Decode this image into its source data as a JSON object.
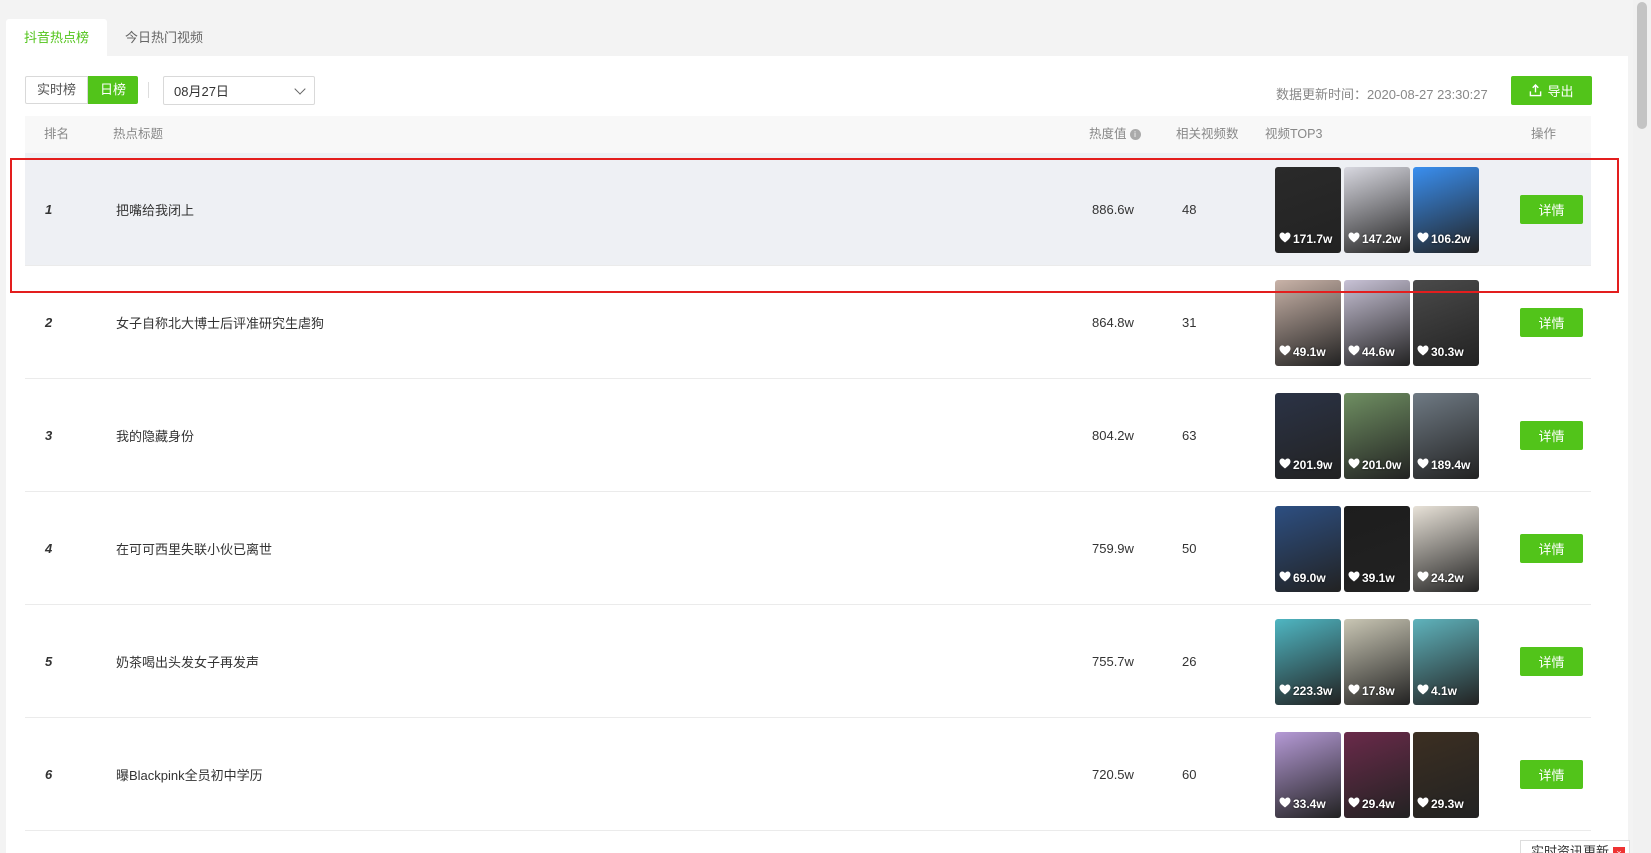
{
  "tabs": [
    {
      "label": "抖音热点榜",
      "active": true
    },
    {
      "label": "今日热门视频",
      "active": false
    }
  ],
  "toolbar": {
    "realtime_label": "实时榜",
    "daily_label": "日榜",
    "date_value": "08月27日",
    "update_text": "数据更新时间：2020-08-27 23:30:27",
    "export_label": "导出"
  },
  "table": {
    "headers": {
      "rank": "排名",
      "title": "热点标题",
      "heat": "热度值",
      "count": "相关视频数",
      "top3": "视频TOP3",
      "action": "操作"
    },
    "detail_label": "详情",
    "rows": [
      {
        "rank": "1",
        "title": "把嘴给我闭上",
        "heat": "886.6w",
        "count": "48",
        "videos": [
          {
            "likes": "171.7w",
            "color": "#2a2a2a"
          },
          {
            "likes": "147.2w",
            "color": "#d8d8e0"
          },
          {
            "likes": "106.2w",
            "color": "#3a8ff0"
          }
        ]
      },
      {
        "rank": "2",
        "title": "女子自称北大博士后评准研究生虐狗",
        "heat": "864.8w",
        "count": "31",
        "videos": [
          {
            "likes": "49.1w",
            "color": "#c9b3a8"
          },
          {
            "likes": "44.6w",
            "color": "#c8c2d6"
          },
          {
            "likes": "30.3w",
            "color": "#4a4a4a"
          }
        ]
      },
      {
        "rank": "3",
        "title": "我的隐藏身份",
        "heat": "804.2w",
        "count": "63",
        "videos": [
          {
            "likes": "201.9w",
            "color": "#2b3346"
          },
          {
            "likes": "201.0w",
            "color": "#6f8f62"
          },
          {
            "likes": "189.4w",
            "color": "#6f7a84"
          }
        ]
      },
      {
        "rank": "4",
        "title": "在可可西里失联小伙已离世",
        "heat": "759.9w",
        "count": "50",
        "videos": [
          {
            "likes": "69.0w",
            "color": "#2d4f82"
          },
          {
            "likes": "39.1w",
            "color": "#1d1d1d"
          },
          {
            "likes": "24.2w",
            "color": "#e8e2d8"
          }
        ]
      },
      {
        "rank": "5",
        "title": "奶茶喝出头发女子再发声",
        "heat": "755.7w",
        "count": "26",
        "videos": [
          {
            "likes": "223.3w",
            "color": "#4fb6c2"
          },
          {
            "likes": "17.8w",
            "color": "#c9c6b4"
          },
          {
            "likes": "4.1w",
            "color": "#5fb3bc"
          }
        ]
      },
      {
        "rank": "6",
        "title": "曝Blackpink全员初中学历",
        "heat": "720.5w",
        "count": "60",
        "videos": [
          {
            "likes": "33.4w",
            "color": "#b59ad6"
          },
          {
            "likes": "29.4w",
            "color": "#6a2a4a"
          },
          {
            "likes": "29.3w",
            "color": "#3c2f22"
          }
        ]
      }
    ]
  },
  "float_tip": "实时资讯更新",
  "colors": {
    "accent": "#52c41a",
    "highlight_border": "#e31e1e",
    "highlight_row": "#eef0f4"
  }
}
